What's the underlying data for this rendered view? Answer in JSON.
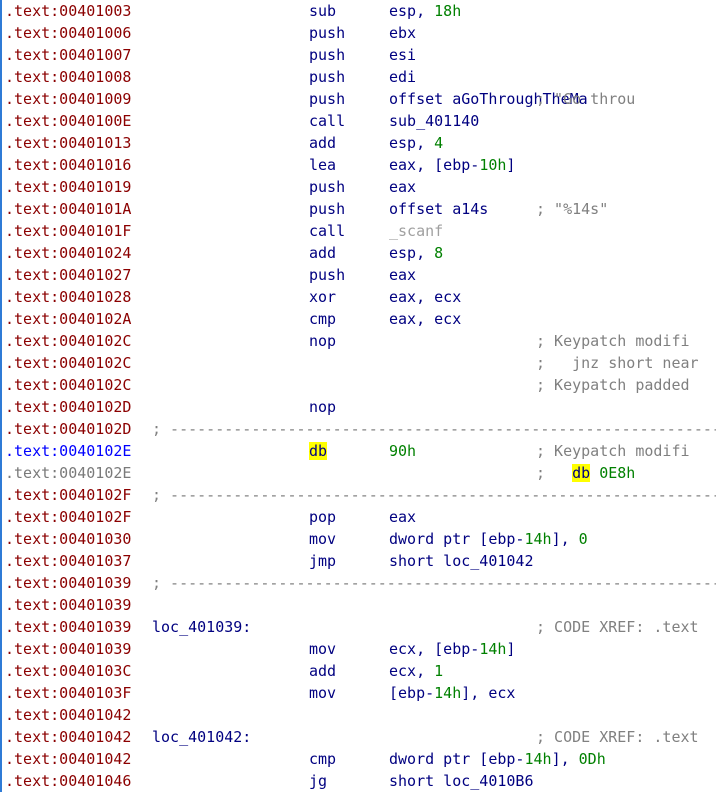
{
  "disassembly": {
    "lines": [
      {
        "address": ".text:00401003",
        "mnemonic": "sub",
        "operand_parts": [
          {
            "text": "esp, "
          },
          {
            "text": "18h",
            "cls": "num"
          }
        ]
      },
      {
        "address": ".text:00401006",
        "mnemonic": "push",
        "operand_parts": [
          {
            "text": "ebx"
          }
        ]
      },
      {
        "address": ".text:00401007",
        "mnemonic": "push",
        "operand_parts": [
          {
            "text": "esi"
          }
        ]
      },
      {
        "address": ".text:00401008",
        "mnemonic": "push",
        "operand_parts": [
          {
            "text": "edi"
          }
        ]
      },
      {
        "address": ".text:00401009",
        "mnemonic": "push",
        "operand_parts": [
          {
            "text": "offset aGoThroughTheMa"
          }
        ],
        "comment": "; \"Go throu"
      },
      {
        "address": ".text:0040100E",
        "mnemonic": "call",
        "operand_parts": [
          {
            "text": "sub_401140"
          }
        ]
      },
      {
        "address": ".text:00401013",
        "mnemonic": "add",
        "operand_parts": [
          {
            "text": "esp, "
          },
          {
            "text": "4",
            "cls": "num"
          }
        ]
      },
      {
        "address": ".text:00401016",
        "mnemonic": "lea",
        "operand_parts": [
          {
            "text": "eax, [ebp-"
          },
          {
            "text": "10h",
            "cls": "num"
          },
          {
            "text": "]"
          }
        ]
      },
      {
        "address": ".text:00401019",
        "mnemonic": "push",
        "operand_parts": [
          {
            "text": "eax"
          }
        ]
      },
      {
        "address": ".text:0040101A",
        "mnemonic": "push",
        "operand_parts": [
          {
            "text": "offset a14s"
          }
        ],
        "comment": "; \"%14s\""
      },
      {
        "address": ".text:0040101F",
        "mnemonic": "call",
        "operand_parts": [
          {
            "text": "_scanf",
            "cls": "dim"
          }
        ]
      },
      {
        "address": ".text:00401024",
        "mnemonic": "add",
        "operand_parts": [
          {
            "text": "esp, "
          },
          {
            "text": "8",
            "cls": "num"
          }
        ]
      },
      {
        "address": ".text:00401027",
        "mnemonic": "push",
        "operand_parts": [
          {
            "text": "eax"
          }
        ]
      },
      {
        "address": ".text:00401028",
        "mnemonic": "xor",
        "operand_parts": [
          {
            "text": "eax, ecx"
          }
        ]
      },
      {
        "address": ".text:0040102A",
        "mnemonic": "cmp",
        "operand_parts": [
          {
            "text": "eax, ecx"
          }
        ]
      },
      {
        "address": ".text:0040102C",
        "mnemonic": "nop",
        "comment_parts": [
          {
            "text": "; Keypatch modifi"
          }
        ]
      },
      {
        "address": ".text:0040102C",
        "comment_parts": [
          {
            "text": ";   jnz short near"
          }
        ]
      },
      {
        "address": ".text:0040102C",
        "comment_parts": [
          {
            "text": "; Keypatch padded"
          }
        ]
      },
      {
        "address": ".text:0040102D",
        "mnemonic": "nop"
      },
      {
        "address": ".text:0040102D",
        "separator": "; ------------------------------------------------------------------------"
      },
      {
        "address": ".text:0040102E",
        "addr_cls": "blue",
        "mnemonic_parts": [
          {
            "text": "db",
            "cls": "hl"
          }
        ],
        "operand_parts": [
          {
            "text": "90h",
            "cls": "num"
          }
        ],
        "comment_parts": [
          {
            "text": "; Keypatch modifi"
          }
        ]
      },
      {
        "address": ".text:0040102E",
        "addr_cls": "gray",
        "comment_parts": [
          {
            "text": ";   "
          },
          {
            "text": "db",
            "cls": "hl ref"
          },
          {
            "text": " 0E8h",
            "cls": "num"
          }
        ]
      },
      {
        "address": ".text:0040102F",
        "separator": "; ------------------------------------------------------------------------"
      },
      {
        "address": ".text:0040102F",
        "mnemonic": "pop",
        "operand_parts": [
          {
            "text": "eax"
          }
        ]
      },
      {
        "address": ".text:00401030",
        "mnemonic": "mov",
        "operand_parts": [
          {
            "text": "dword ptr [ebp-"
          },
          {
            "text": "14h",
            "cls": "num"
          },
          {
            "text": "], "
          },
          {
            "text": "0",
            "cls": "num"
          }
        ]
      },
      {
        "address": ".text:00401037",
        "mnemonic": "jmp",
        "operand_parts": [
          {
            "text": "short loc_401042"
          }
        ]
      },
      {
        "address": ".text:00401039",
        "separator": "; ------------------------------------------------------------------------"
      },
      {
        "address": ".text:00401039"
      },
      {
        "address": ".text:00401039",
        "label": "loc_401039:",
        "comment": "; CODE XREF: .text"
      },
      {
        "address": ".text:00401039",
        "mnemonic": "mov",
        "operand_parts": [
          {
            "text": "ecx, [ebp-"
          },
          {
            "text": "14h",
            "cls": "num"
          },
          {
            "text": "]"
          }
        ]
      },
      {
        "address": ".text:0040103C",
        "mnemonic": "add",
        "operand_parts": [
          {
            "text": "ecx, "
          },
          {
            "text": "1",
            "cls": "num"
          }
        ]
      },
      {
        "address": ".text:0040103F",
        "mnemonic": "mov",
        "operand_parts": [
          {
            "text": "[ebp-"
          },
          {
            "text": "14h",
            "cls": "num"
          },
          {
            "text": "], ecx"
          }
        ]
      },
      {
        "address": ".text:00401042"
      },
      {
        "address": ".text:00401042",
        "label": "loc_401042:",
        "comment": "; CODE XREF: .text"
      },
      {
        "address": ".text:00401042",
        "mnemonic": "cmp",
        "operand_parts": [
          {
            "text": "dword ptr [ebp-"
          },
          {
            "text": "14h",
            "cls": "num"
          },
          {
            "text": "], "
          },
          {
            "text": "0Dh",
            "cls": "num"
          }
        ]
      },
      {
        "address": ".text:00401046",
        "mnemonic": "jg",
        "operand_parts": [
          {
            "text": "short loc_4010B6"
          }
        ]
      }
    ]
  }
}
